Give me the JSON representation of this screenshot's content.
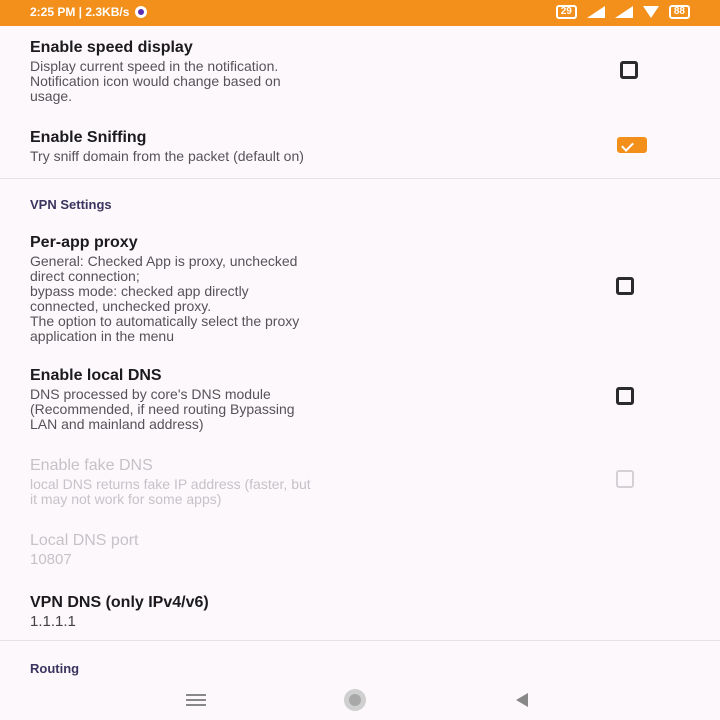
{
  "status_bar": {
    "time_info": "2:25 PM | 2.3KB/s",
    "indicators": "29",
    "battery": "88"
  },
  "settings": {
    "speed_display": {
      "title": "Enable speed display",
      "summary": "Display current speed in the notification.\nNotification icon would change based on\nusage.",
      "checked": false
    },
    "sniffing": {
      "title": "Enable Sniffing",
      "summary": "Try sniff domain from the packet (default on)",
      "checked": true
    },
    "vpn_section_header": "VPN Settings",
    "per_app_proxy": {
      "title": "Per-app proxy",
      "summary": "General: Checked App is proxy, unchecked\ndirect connection;\nbypass mode: checked app directly\nconnected, unchecked proxy.\nThe option to automatically select the proxy\napplication in the menu",
      "checked": false
    },
    "local_dns": {
      "title": "Enable local DNS",
      "summary": "DNS processed by core's DNS module\n(Recommended, if need routing Bypassing\nLAN and mainland address)",
      "checked": false
    },
    "fake_dns": {
      "title": "Enable fake DNS",
      "summary": "local DNS returns fake IP address (faster, but\nit may not work for some apps)",
      "checked": false,
      "enabled": false
    },
    "local_dns_port": {
      "title": "Local DNS port",
      "value": "10807",
      "enabled": false
    },
    "vpn_dns": {
      "title": "VPN DNS (only IPv4/v6)",
      "value": "1.1.1.1"
    },
    "routing_section_header": "Routing"
  },
  "colors": {
    "accent": "#f2901b",
    "background": "#fdf8fb",
    "section_header": "#3b3560"
  },
  "icons": {
    "status_left": "vpn-dot-icon",
    "status_right": [
      "signal-icon",
      "wifi-icon",
      "battery-icon"
    ],
    "nav": [
      "recents-icon",
      "home-icon",
      "back-icon"
    ]
  }
}
